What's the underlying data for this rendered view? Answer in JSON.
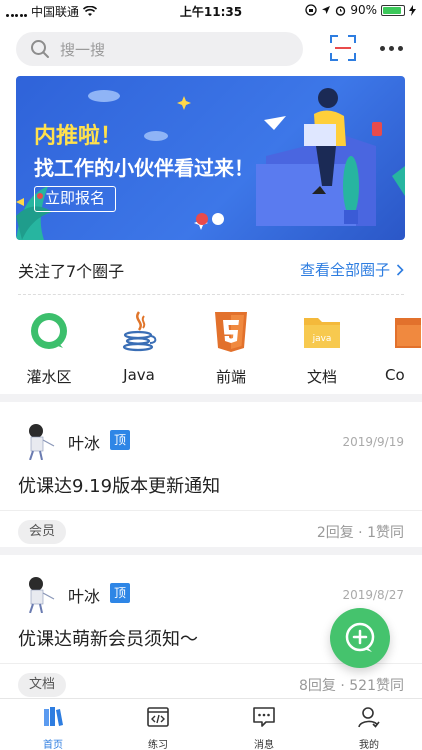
{
  "status_bar": {
    "carrier": "中国联通",
    "time": "上午11:35",
    "battery": "90%",
    "battery_level": 0.9
  },
  "search": {
    "placeholder": "搜一搜",
    "icon": "search-icon"
  },
  "toolbar": {
    "scan_icon": "scan-icon",
    "more_icon": "more-icon"
  },
  "banner": {
    "headline": "内推啦！",
    "subline": "找工作的小伙伴看过来！",
    "cta": "立即报名"
  },
  "circles": {
    "heading": "关注了7个圈子",
    "view_all": "查看全部圈子",
    "items": [
      {
        "label": "灌水区",
        "icon": "chat-bubble-icon",
        "color": "#3cbf6c"
      },
      {
        "label": "Java",
        "icon": "java-icon",
        "color": "#e0752b"
      },
      {
        "label": "前端",
        "icon": "html5-icon",
        "color": "#e2712c"
      },
      {
        "label": "文档",
        "icon": "folder-icon",
        "color": "#f4b93b"
      },
      {
        "label": "Co",
        "icon": "folder-icon",
        "color": "#e2712c"
      }
    ]
  },
  "posts": [
    {
      "author": "叶冰",
      "badge": "顶",
      "date": "2019/9/19",
      "title": "优课达9.19版本更新通知",
      "tag": "会员",
      "stats": "2回复 · 1赞同"
    },
    {
      "author": "叶冰",
      "badge": "顶",
      "date": "2019/8/27",
      "title": "优课达萌新会员须知～",
      "tag": "文档",
      "stats": "8回复 · 521赞同"
    }
  ],
  "fab": {
    "icon": "add-chat-icon"
  },
  "tabs": [
    {
      "label": "首页",
      "icon": "home-books-icon",
      "active": true
    },
    {
      "label": "练习",
      "icon": "code-icon",
      "active": false
    },
    {
      "label": "消息",
      "icon": "message-icon",
      "active": false
    },
    {
      "label": "我的",
      "icon": "profile-icon",
      "active": false
    }
  ],
  "colors": {
    "accent": "#2e7de0",
    "fab": "#45c36d",
    "badge": "#2e86e6"
  }
}
